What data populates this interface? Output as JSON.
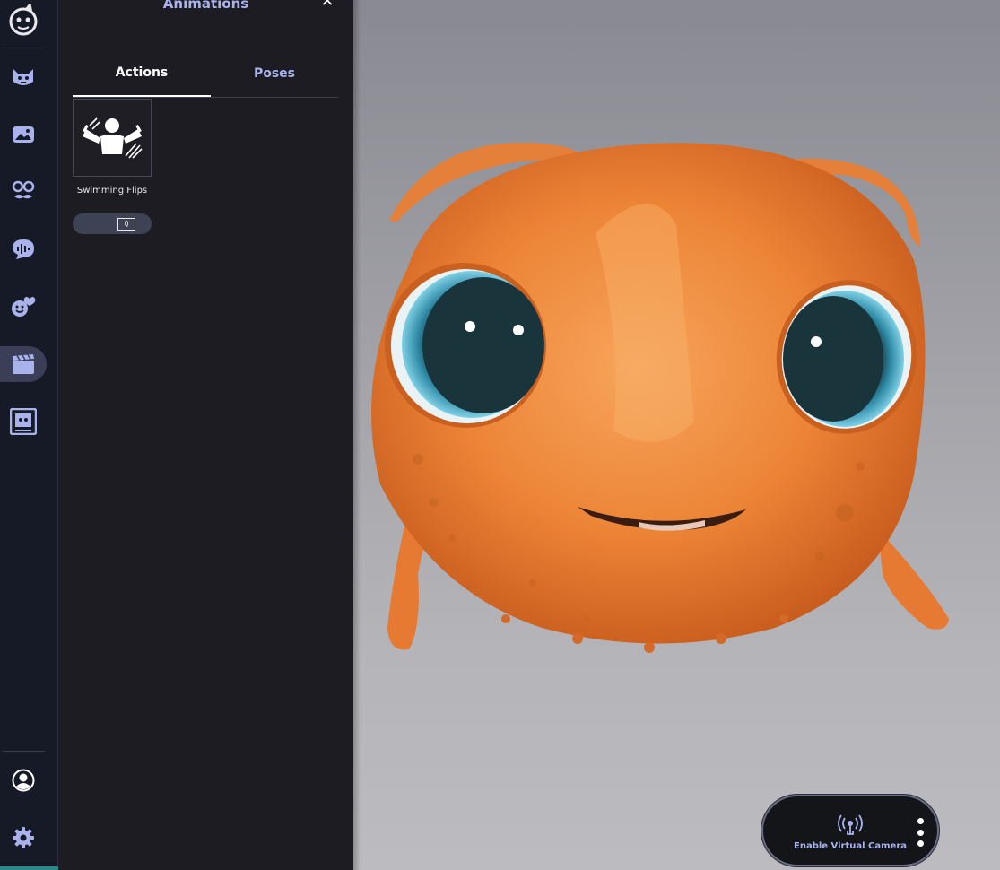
{
  "panel": {
    "title": "Animations",
    "close_label": "✕"
  },
  "tabs": [
    {
      "label": "Actions",
      "active": true
    },
    {
      "label": "Poses",
      "active": false
    }
  ],
  "animations": [
    {
      "name": "Swimming Flips",
      "hotkey": "Q",
      "icon": "swimming-flips-icon"
    }
  ],
  "virtual_camera": {
    "label": "Enable Virtual Camera",
    "icon": "broadcast-icon"
  },
  "rail": {
    "items": [
      {
        "icon": "app-logo-icon"
      },
      {
        "icon": "avatar-face-icon"
      },
      {
        "icon": "background-image-icon"
      },
      {
        "icon": "accessories-icon"
      },
      {
        "icon": "voice-icon"
      },
      {
        "icon": "emotes-icon"
      },
      {
        "icon": "animations-icon",
        "active": true
      },
      {
        "icon": "overlay-icon"
      },
      {
        "icon": "account-icon"
      },
      {
        "icon": "settings-icon"
      }
    ]
  },
  "colors": {
    "accent": "#aab2ec",
    "rail_bg": "#161a26",
    "panel_bg": "#1c1c22",
    "avatar_orange": "#e8803a"
  }
}
